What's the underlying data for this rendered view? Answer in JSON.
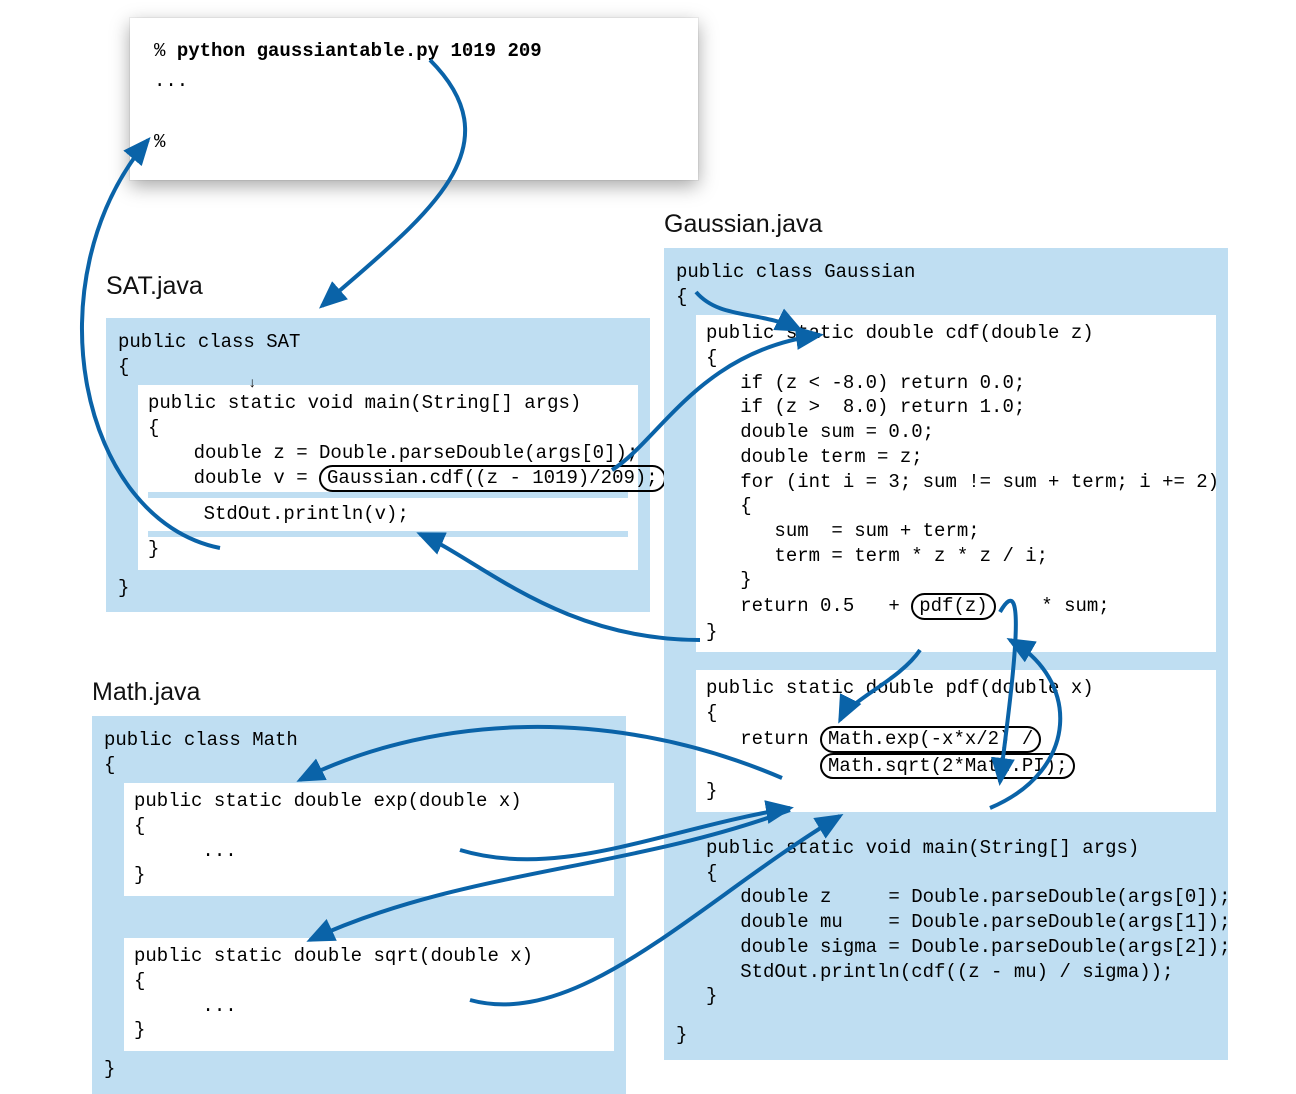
{
  "terminal": {
    "prompt1": "% ",
    "cmd": "python gaussiantable.py 1019 209",
    "ellipsis": "...",
    "prompt2": "%"
  },
  "sat": {
    "label": "SAT.java",
    "header": "public class SAT\n{",
    "main_sig": "public static void main(String[] args)\n{",
    "line_z": "    double z = Double.parseDouble(args[0]);",
    "line_v_pre": "    double v = ",
    "line_v_call": "Gaussian.cdf((z - 1019)/209);",
    "blank": "",
    "line_out": "    StdOut.println(v);",
    "close_inner": "}",
    "close_outer": "}"
  },
  "math": {
    "label": "Math.java",
    "header": "public class Math\n{",
    "exp_sig": "public static double exp(double x)\n{\n      ...\n}",
    "sqrt_sig": "public static double sqrt(double x)\n{\n      ...\n}",
    "close": "}"
  },
  "gauss": {
    "label": "Gaussian.java",
    "header": "public class Gaussian\n{",
    "cdf_sig": "public static double cdf(double z)\n{",
    "cdf_body1": "   if (z < -8.0) return 0.0;\n   if (z >  8.0) return 1.0;\n   double sum = 0.0;\n   double term = z;\n   for (int i = 3; sum != sum + term; i += 2)\n   {\n      sum  = sum + term;\n      term = term * z * z / i;\n   }",
    "cdf_ret_pre": "   return 0.5   + ",
    "cdf_ret_call": "pdf(z)",
    "cdf_ret_post": "    * sum;",
    "cdf_close": "}",
    "pdf_sig": "public static double pdf(double x)\n{",
    "pdf_ret_pre": "   return ",
    "pdf_call1": "Math.exp(-x*x/2) /",
    "pdf_call2": "Math.sqrt(2*Math.PI);",
    "pdf_close": "}",
    "main_sig": "public static void main(String[] args)\n{\n   double z     = Double.parseDouble(args[0]);\n   double mu    = Double.parseDouble(args[1]);\n   double sigma = Double.parseDouble(args[2]);\n   StdOut.println(cdf((z - mu) / sigma));\n}",
    "close": "}"
  },
  "colors": {
    "panel": "#bfdef2",
    "arrow": "#0a63a8"
  }
}
